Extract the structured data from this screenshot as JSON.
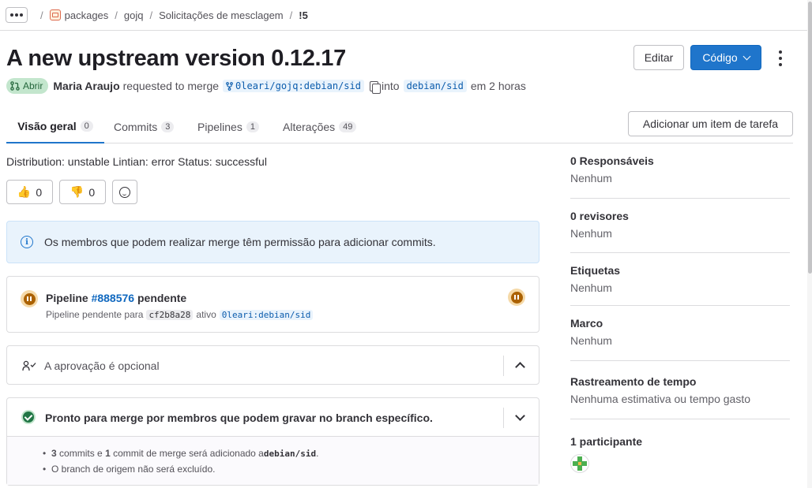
{
  "breadcrumb": {
    "items": [
      "packages",
      "gojq",
      "Solicitações de mesclagem",
      "!5"
    ]
  },
  "header": {
    "title": "A new upstream version 0.12.17",
    "edit_label": "Editar",
    "code_label": "Código"
  },
  "meta": {
    "status": "Abrir",
    "author": "Maria Araujo",
    "requested_text": "requested to merge",
    "source_branch": "0leari/gojq:debian/sid",
    "into_text": "into",
    "target_branch": "debian/sid",
    "time_text": "em 2 horas"
  },
  "tabs": [
    {
      "label": "Visão geral",
      "count": "0"
    },
    {
      "label": "Commits",
      "count": "3"
    },
    {
      "label": "Pipelines",
      "count": "1"
    },
    {
      "label": "Alterações",
      "count": "49"
    }
  ],
  "task_button_label": "Adicionar um item de tarefa",
  "description": "Distribution: unstable Lintian: error Status: successful",
  "reactions": {
    "thumbs_up": {
      "emoji": "👍",
      "count": "0"
    },
    "thumbs_down": {
      "emoji": "👎",
      "count": "0"
    }
  },
  "alert_text": "Os membros que podem realizar merge têm permissão para adicionar commits.",
  "pipeline": {
    "prefix": "Pipeline",
    "id": "#888576",
    "status": "pendente",
    "sub_text": "Pipeline pendente para",
    "commit": "cf2b8a28",
    "active_text": "ativo",
    "branch": "0leari:debian/sid"
  },
  "approval_text": "A aprovação é opcional",
  "merge": {
    "title": "Pronto para merge por membros que podem gravar no branch específico.",
    "line1": {
      "count": "3",
      "t1": "commits e",
      "count2": "1",
      "t2": "commit de merge será adicionado a",
      "branch": "debian/sid",
      "t3": "."
    },
    "line2": "O branch de origem não será excluído."
  },
  "sidebar": {
    "assignees_label": "0 Responsáveis",
    "assignees_value": "Nenhum",
    "reviewers_label": "0 revisores",
    "reviewers_value": "Nenhum",
    "labels_label": "Etiquetas",
    "labels_value": "Nenhum",
    "milestone_label": "Marco",
    "milestone_value": "Nenhum",
    "time_label": "Rastreamento de tempo",
    "time_value": "Nenhuma estimativa ou tempo gasto",
    "participants_label": "1 participante"
  },
  "colors": {
    "primary": "#1f75cb",
    "open_badge_bg": "#c3e6cd",
    "pending": "#ab6100",
    "success": "#217645",
    "info_bg": "#e9f3fc"
  }
}
